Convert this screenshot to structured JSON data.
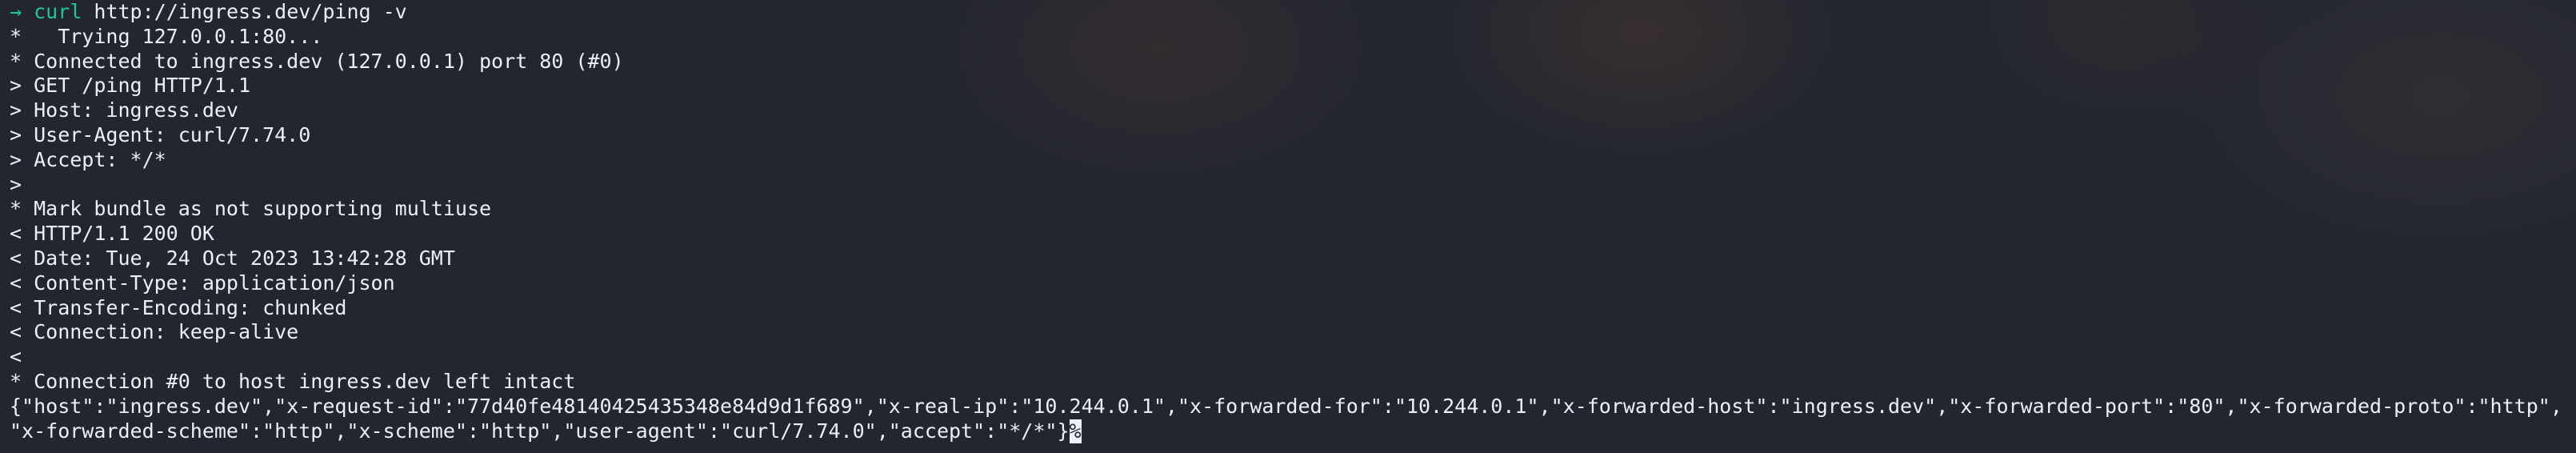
{
  "terminal": {
    "prompt_symbol": "→",
    "command_name": "curl",
    "command_args": " http://ingress.dev/ping -v",
    "lines": [
      "*   Trying 127.0.0.1:80...",
      "* Connected to ingress.dev (127.0.0.1) port 80 (#0)",
      "> GET /ping HTTP/1.1",
      "> Host: ingress.dev",
      "> User-Agent: curl/7.74.0",
      "> Accept: */*",
      ">",
      "* Mark bundle as not supporting multiuse",
      "< HTTP/1.1 200 OK",
      "< Date: Tue, 24 Oct 2023 13:42:28 GMT",
      "< Content-Type: application/json",
      "< Transfer-Encoding: chunked",
      "< Connection: keep-alive",
      "<",
      "* Connection #0 to host ingress.dev left intact",
      "{\"host\":\"ingress.dev\",\"x-request-id\":\"77d40fe48140425435348e84d9d1f689\",\"x-real-ip\":\"10.244.0.1\",\"x-forwarded-for\":\"10.244.0.1\",\"x-forwarded-host\":\"ingress.dev\",\"x-forwarded-port\":\"80\",\"x-forwarded-proto\":\"http\","
    ],
    "last_line": "\"x-forwarded-scheme\":\"http\",\"x-scheme\":\"http\",\"user-agent\":\"curl/7.74.0\",\"accept\":\"*/*\"}",
    "cursor_char": "%"
  },
  "colors": {
    "background": "#23262f",
    "foreground": "#eceff4",
    "prompt_accent": "#1ec59a"
  }
}
